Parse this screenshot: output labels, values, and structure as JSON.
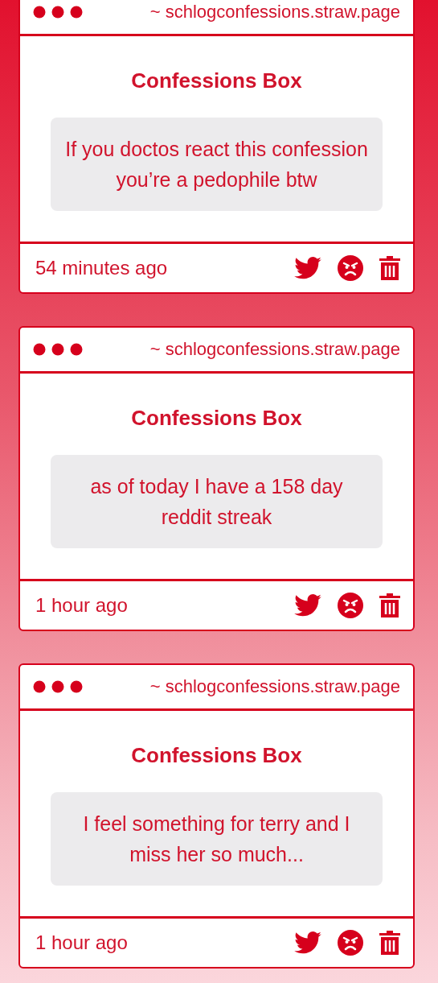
{
  "cards": [
    {
      "url": "~ schlogconfessions.straw.page",
      "title": "Confessions Box",
      "message": "If you doctos react this confession you’re a pedophile btw",
      "time": "54 minutes ago"
    },
    {
      "url": "~ schlogconfessions.straw.page",
      "title": "Confessions Box",
      "message": "as of today I have a 158 day reddit streak",
      "time": "1 hour ago"
    },
    {
      "url": "~ schlogconfessions.straw.page",
      "title": "Confessions Box",
      "message": "I feel something for terry and I miss her so much...",
      "time": "1 hour ago"
    }
  ]
}
